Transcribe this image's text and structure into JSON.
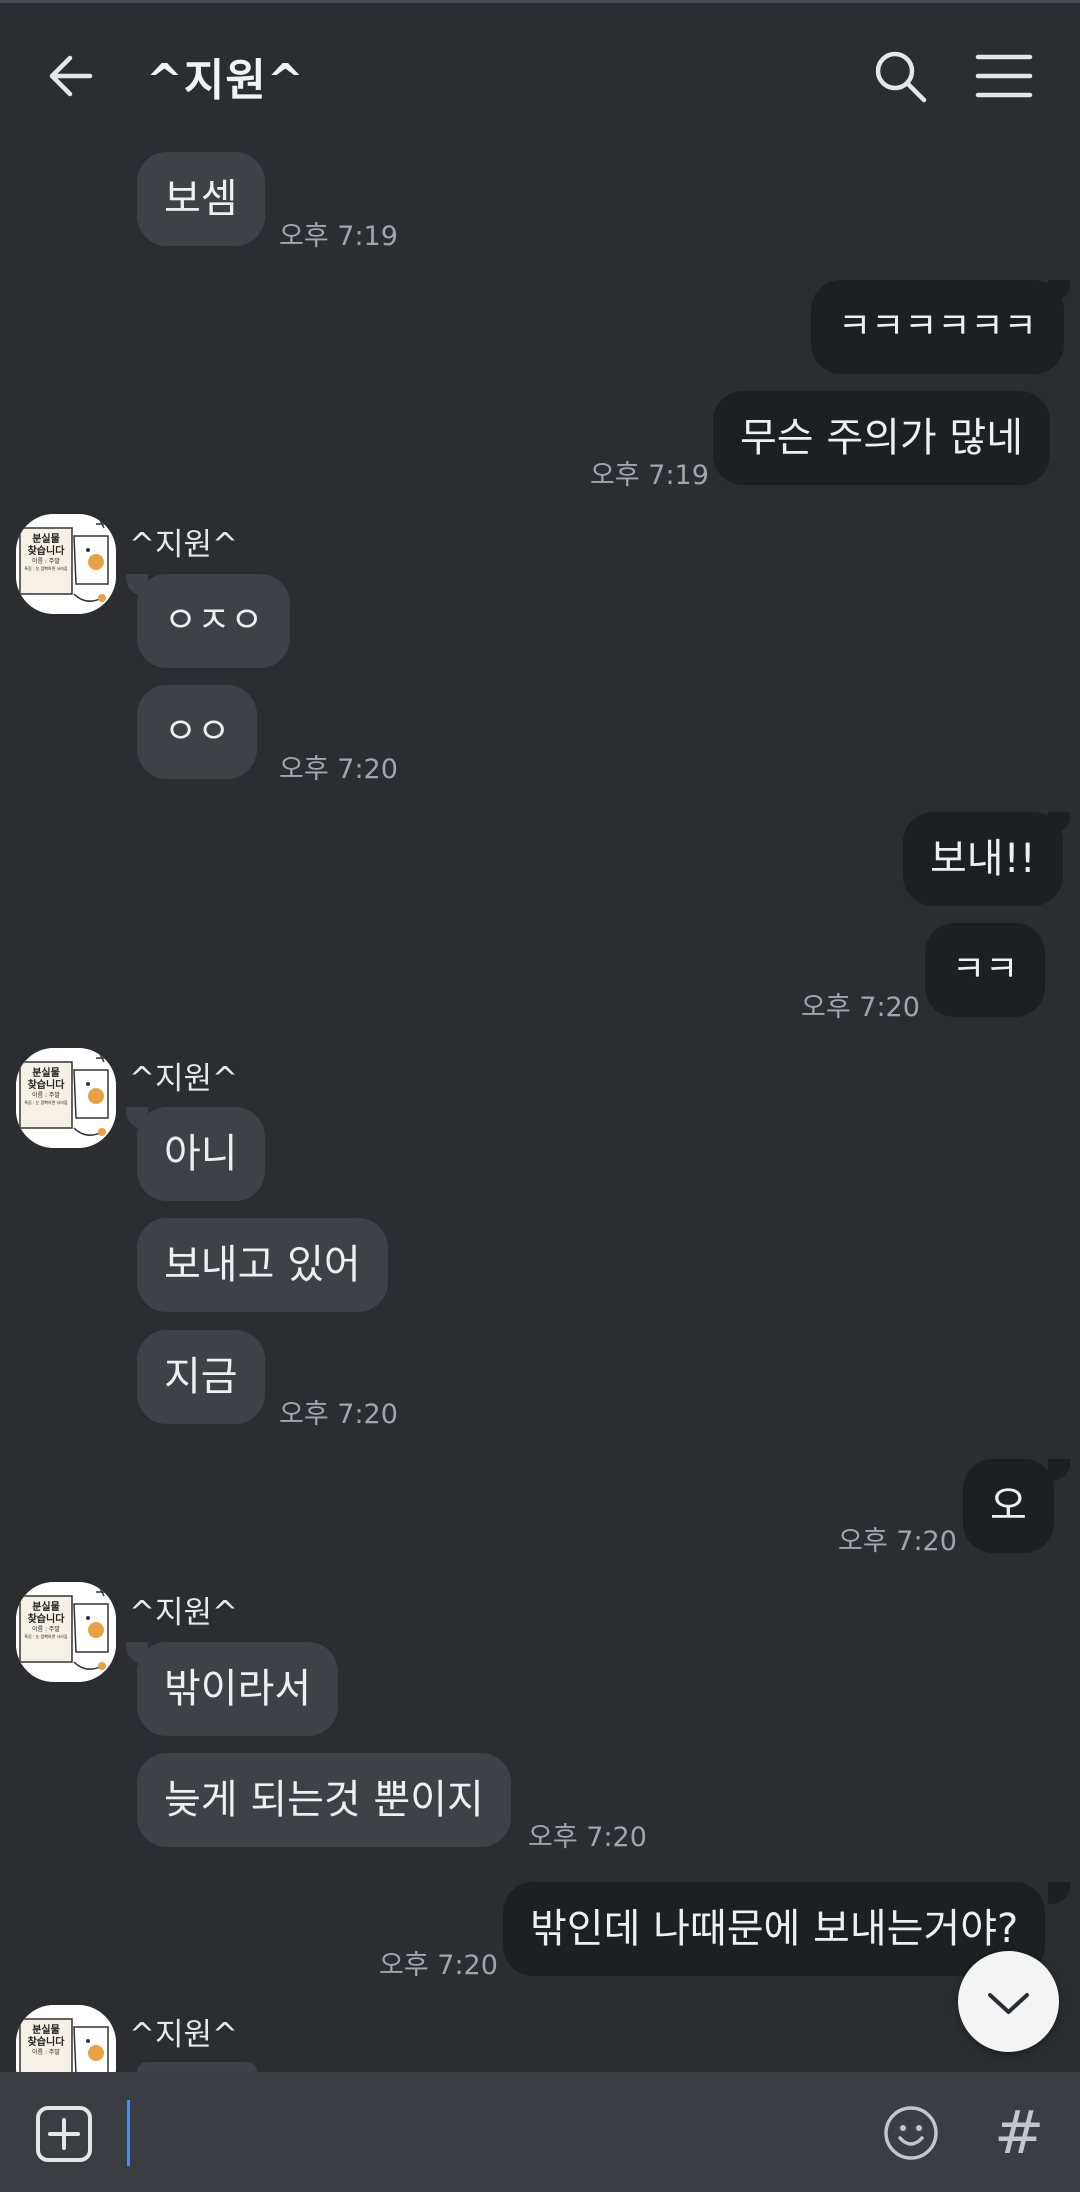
{
  "header": {
    "title": "^지원^",
    "back_icon": "arrow-left-icon",
    "search_icon": "search-icon",
    "menu_icon": "hamburger-menu-icon"
  },
  "avatar": {
    "sticker_text_line1": "분실물",
    "sticker_text_line2": "찾습니다",
    "sticker_text_line3": "이름 : 주말",
    "sticker_text_line4": "특징 : 눈 깜빡하면 사라짐"
  },
  "messages": [
    {
      "side": "left",
      "text": "보셈",
      "time": "오후 7:19"
    },
    {
      "side": "right",
      "text": "ㅋㅋㅋㅋㅋㅋ"
    },
    {
      "side": "right",
      "text": "무슨 주의가 많네",
      "time": "오후 7:19"
    },
    {
      "side": "left",
      "sender": "^지원^",
      "text": "ㅇㅈㅇ"
    },
    {
      "side": "left",
      "text": "ㅇㅇ",
      "time": "오후 7:20"
    },
    {
      "side": "right",
      "text": "보내!!"
    },
    {
      "side": "right",
      "text": "ㅋㅋ",
      "time": "오후 7:20"
    },
    {
      "side": "left",
      "sender": "^지원^",
      "text": "아니"
    },
    {
      "side": "left",
      "text": "보내고 있어"
    },
    {
      "side": "left",
      "text": "지금",
      "time": "오후 7:20"
    },
    {
      "side": "right",
      "text": "오",
      "time": "오후 7:20"
    },
    {
      "side": "left",
      "sender": "^지원^",
      "text": "밖이라서"
    },
    {
      "side": "left",
      "text": "늦게 되는것 뿐이지",
      "time": "오후 7:20"
    },
    {
      "side": "right",
      "text": "밖인데 나때문에 보내는거야?",
      "time": "오후 7:20"
    },
    {
      "side": "left",
      "sender": "^지원^",
      "text": ""
    }
  ],
  "input_bar": {
    "attach_icon": "plus-square-icon",
    "emoji_icon": "emoji-icon",
    "hashtag_label": "#"
  },
  "scroll_button_icon": "chevron-down-icon"
}
